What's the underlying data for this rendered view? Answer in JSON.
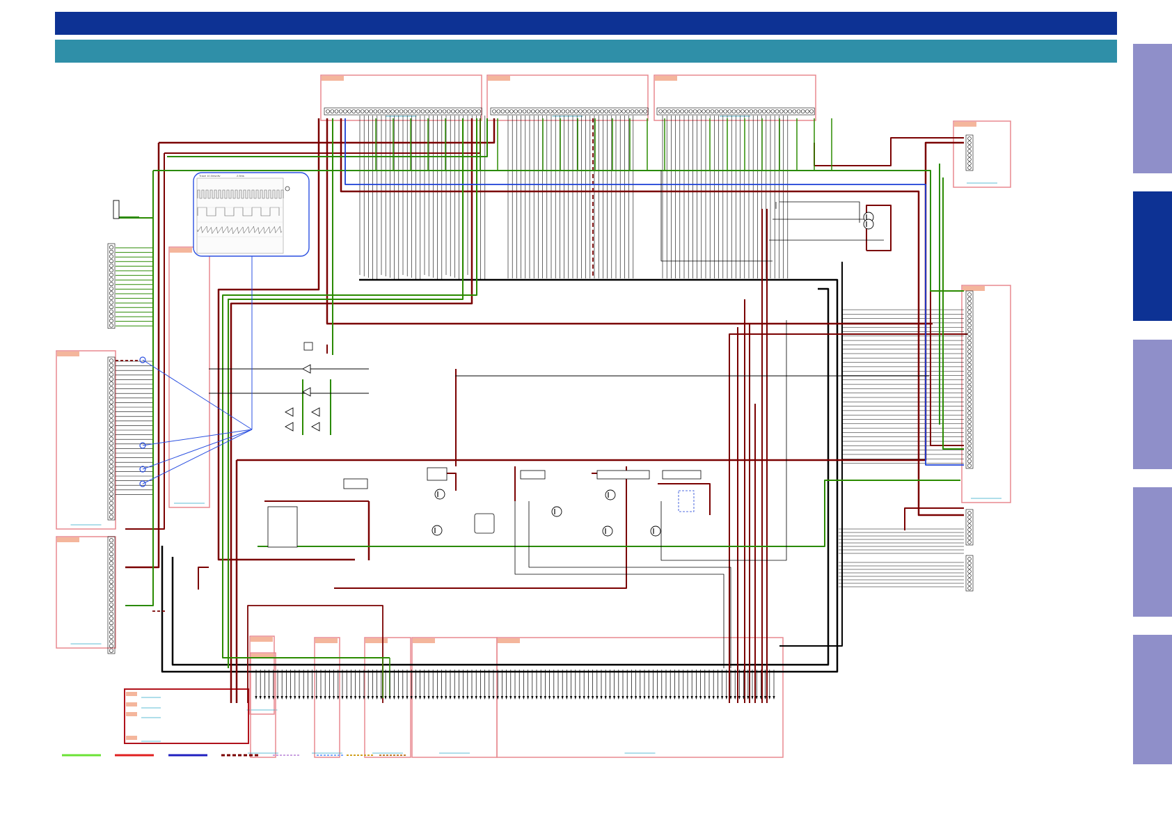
{
  "header": {
    "title": "",
    "subtitle": "",
    "colors": {
      "title_band": "#0d3294",
      "subtitle_band": "#2f8fa8"
    }
  },
  "side_tabs": [
    {
      "label": "",
      "active": false,
      "color": "#8f8fc9"
    },
    {
      "label": "",
      "active": true,
      "color": "#0d3294"
    },
    {
      "label": "",
      "active": false,
      "color": "#8f8fc9"
    },
    {
      "label": "",
      "active": false,
      "color": "#8f8fc9"
    },
    {
      "label": "",
      "active": false,
      "color": "#8f8fc9"
    }
  ],
  "schematic": {
    "wire_colors": {
      "ground_green": "#2a8a00",
      "power_darkred": "#7a0000",
      "signal_black": "#000000",
      "bus_blue": "#1a3fd6",
      "frame_pink": "#e8898f",
      "callout_blue": "#2a4fe0",
      "tag_salmon": "#f4b69c"
    },
    "waveform_callout": {
      "header_text_1": "Trace  10.0ms/div",
      "header_text_2": "2.5ms"
    },
    "legend": [
      {
        "name": "legend-green-line",
        "color": "#6be236",
        "style": "solid"
      },
      {
        "name": "legend-red-line",
        "color": "#e02020",
        "style": "solid"
      },
      {
        "name": "legend-blue-line",
        "color": "#2020c0",
        "style": "solid"
      },
      {
        "name": "legend-darkred-dash",
        "color": "#7a0000",
        "style": "dashed"
      }
    ]
  }
}
